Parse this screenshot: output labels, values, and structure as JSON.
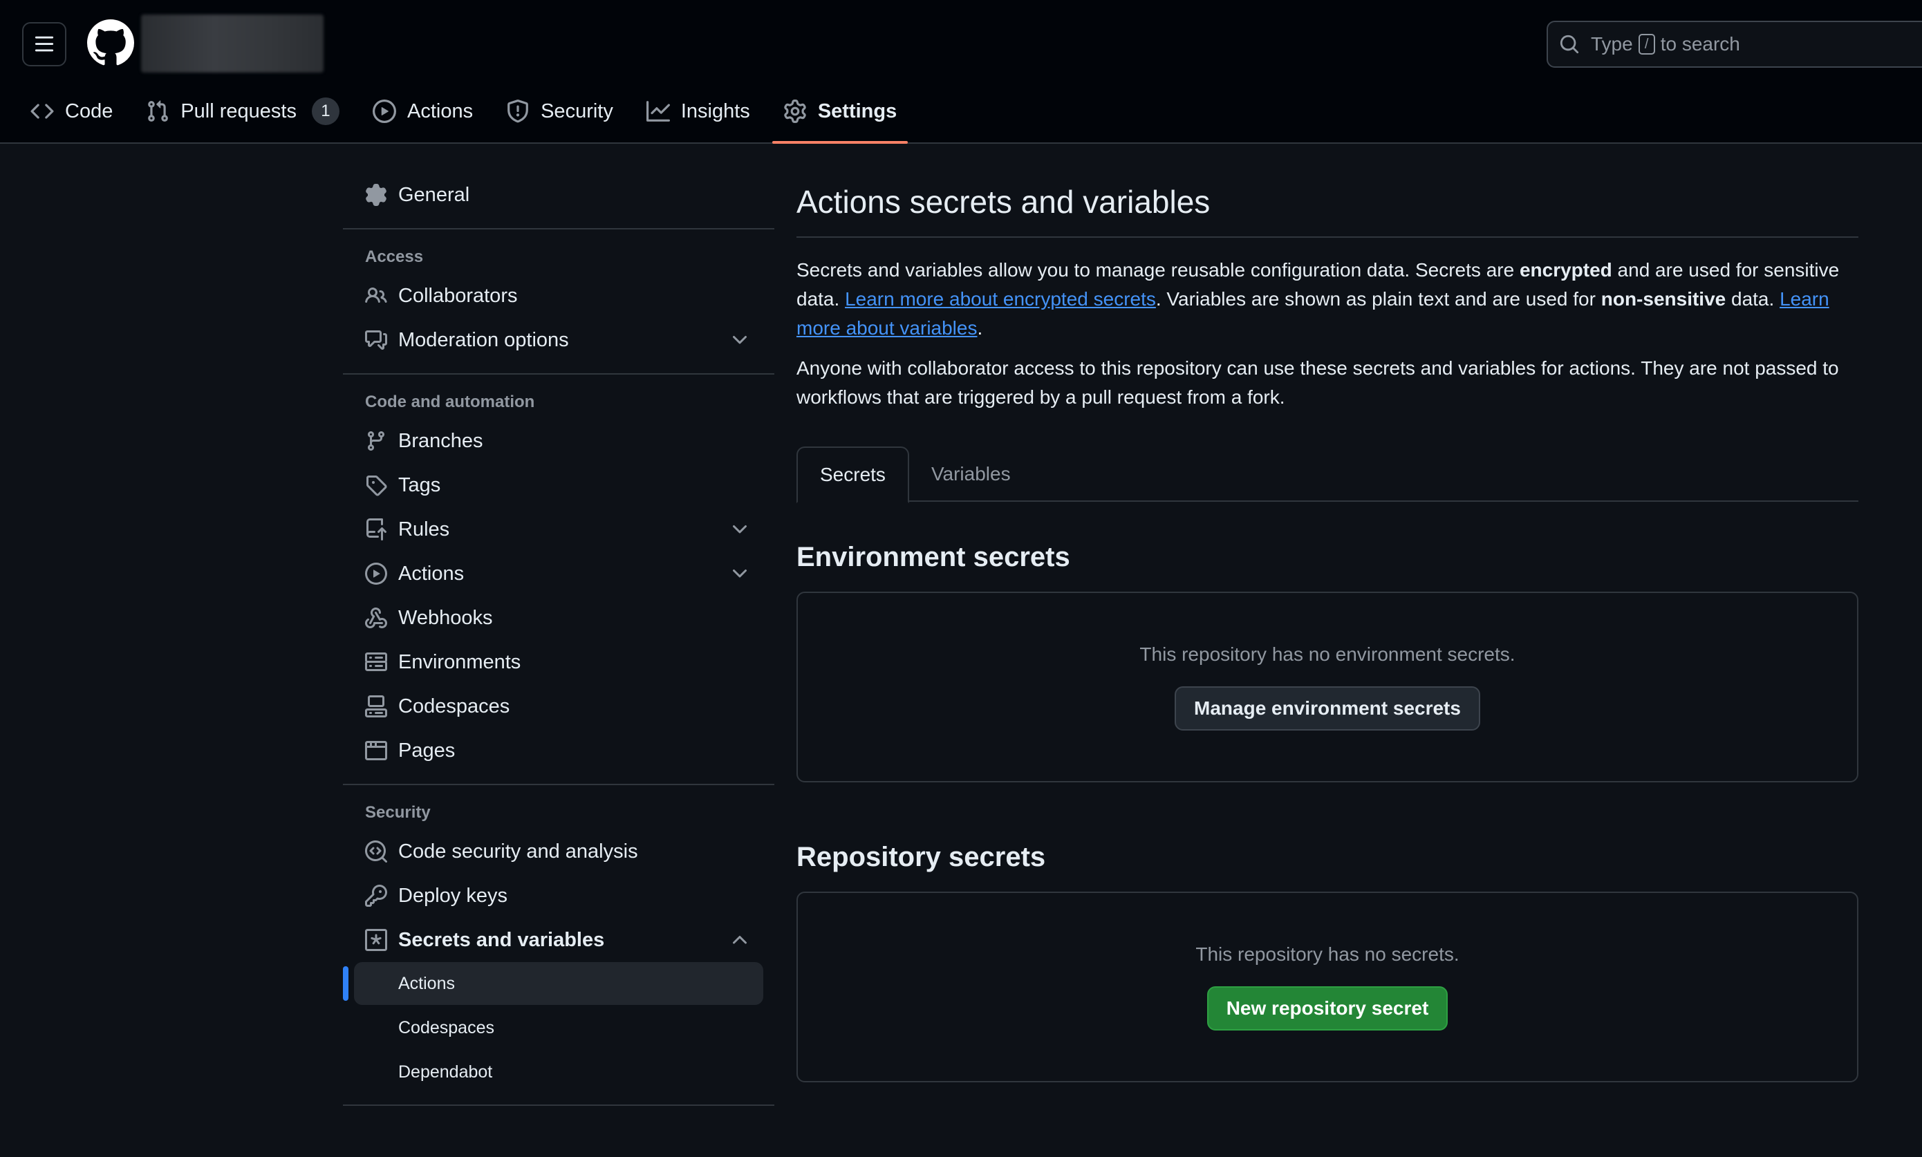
{
  "header": {
    "search_prefix": "Type",
    "search_key": "/",
    "search_suffix": "to search"
  },
  "nav": {
    "tabs": [
      {
        "label": "Code",
        "icon": "code-icon"
      },
      {
        "label": "Pull requests",
        "icon": "git-pull-request-icon",
        "count": "1"
      },
      {
        "label": "Actions",
        "icon": "play-icon"
      },
      {
        "label": "Security",
        "icon": "shield-icon"
      },
      {
        "label": "Insights",
        "icon": "graph-icon"
      },
      {
        "label": "Settings",
        "icon": "gear-icon",
        "active": true
      }
    ]
  },
  "sidebar": {
    "general": "General",
    "access_heading": "Access",
    "collaborators": "Collaborators",
    "moderation": "Moderation options",
    "code_heading": "Code and automation",
    "branches": "Branches",
    "tags": "Tags",
    "rules": "Rules",
    "actions": "Actions",
    "webhooks": "Webhooks",
    "environments": "Environments",
    "codespaces": "Codespaces",
    "pages": "Pages",
    "security_heading": "Security",
    "code_security": "Code security and analysis",
    "deploy_keys": "Deploy keys",
    "secrets": "Secrets and variables",
    "secrets_sub": [
      "Actions",
      "Codespaces",
      "Dependabot"
    ]
  },
  "main": {
    "title": "Actions secrets and variables",
    "p1_a": "Secrets and variables allow you to manage reusable configuration data. Secrets are ",
    "p1_b": "encrypted",
    "p1_c": " and are used for sensitive data. ",
    "p1_link1": "Learn more about encrypted secrets",
    "p1_d": ". Variables are shown as plain text and are used for ",
    "p1_e": "non-sensitive",
    "p1_f": " data. ",
    "p1_link2": "Learn more about variables",
    "p1_g": ".",
    "p2": "Anyone with collaborator access to this repository can use these secrets and variables for actions. They are not passed to workflows that are triggered by a pull request from a fork.",
    "tabs": [
      "Secrets",
      "Variables"
    ],
    "env_title": "Environment secrets",
    "env_empty": "This repository has no environment secrets.",
    "env_button": "Manage environment secrets",
    "repo_title": "Repository secrets",
    "repo_empty": "This repository has no secrets.",
    "repo_button": "New repository secret"
  },
  "colors": {
    "background": "#0d1117",
    "header": "#010409",
    "accent_underline": "#f78166",
    "link": "#4493f8",
    "primary_button": "#238636",
    "active_indicator": "#2f81f7"
  }
}
